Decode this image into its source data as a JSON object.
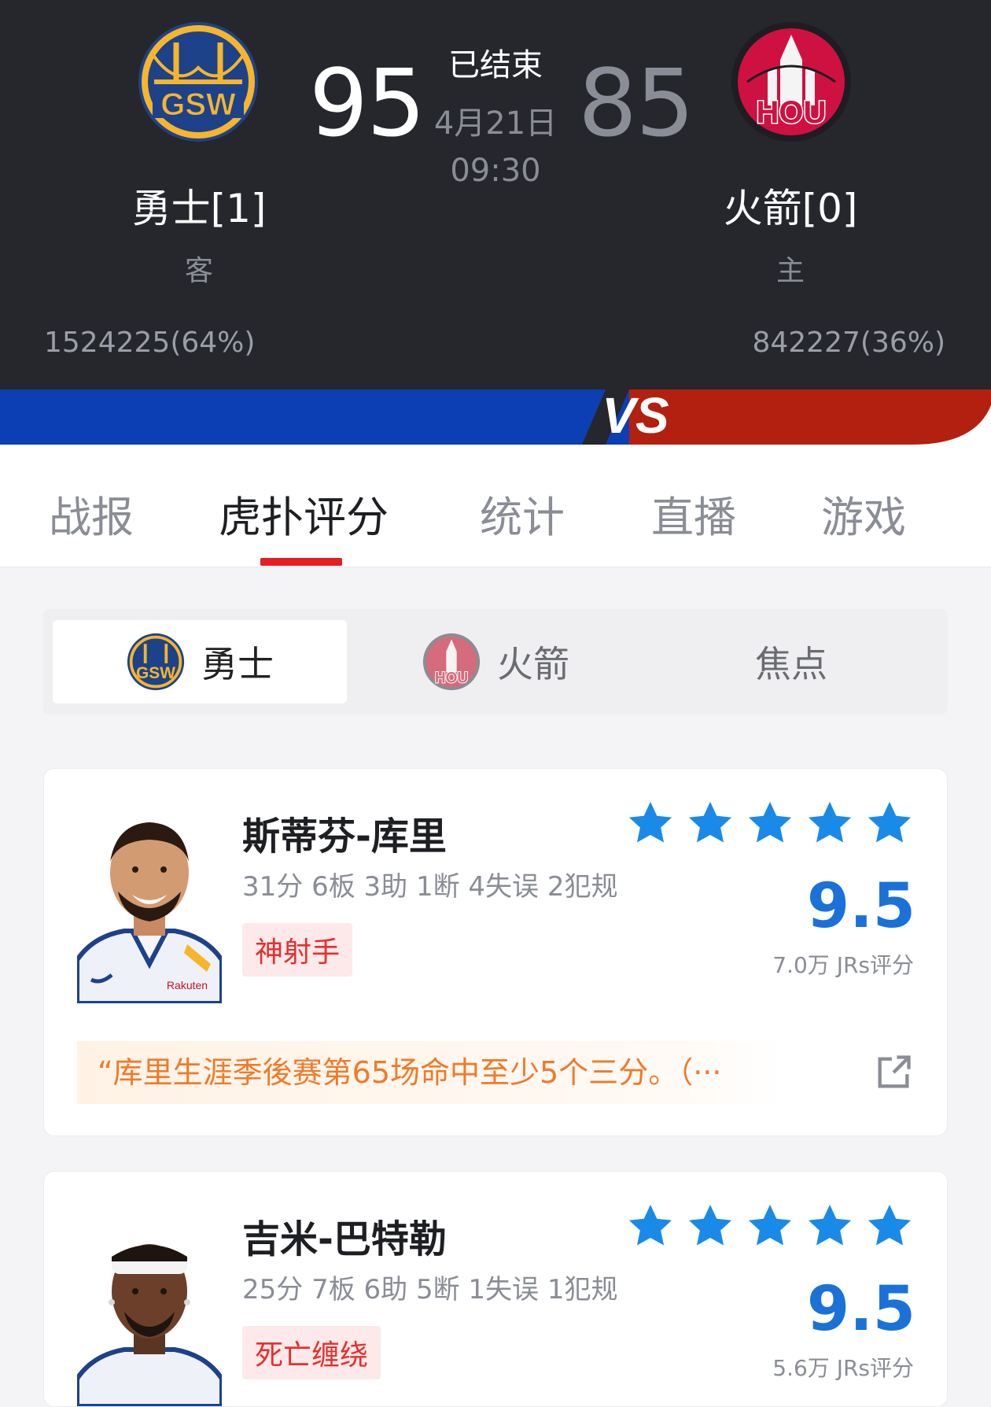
{
  "game": {
    "status": "已结束",
    "date": "4月21日",
    "time": "09:30",
    "away": {
      "abbr": "GSW",
      "name": "勇士[1]",
      "side": "客",
      "score": "95",
      "support": "1524225(64%)",
      "color": "#1d428a",
      "accent": "#f7b52c"
    },
    "home": {
      "abbr": "HOU",
      "name": "火箭[0]",
      "side": "主",
      "score": "85",
      "support": "842227(36%)",
      "color": "#ce1141",
      "accent": "#ffffff"
    },
    "vs_label": "VS"
  },
  "tabs": [
    "战报",
    "虎扑评分",
    "统计",
    "直播",
    "游戏"
  ],
  "active_tab": "虎扑评分",
  "segments": {
    "warriors": "勇士",
    "rockets": "火箭",
    "focus": "焦点"
  },
  "players": [
    {
      "name": "斯蒂芬-库里",
      "stats": "31分 6板 3助 1断 4失误 2犯规",
      "badge": "神射手",
      "stars": 5,
      "rating": "9.5",
      "rating_count": "7.0万 JRs评分",
      "quote": "“库里生涯季後赛第65场命中至少5个三分。（···"
    },
    {
      "name": "吉米-巴特勒",
      "stats": "25分 7板 6助 5断 1失误 1犯规",
      "badge": "死亡缠绕",
      "stars": 5,
      "rating": "9.5",
      "rating_count": "5.6万 JRs评分"
    }
  ],
  "colors": {
    "header_bg": "#25272d",
    "blue_bar": "#0c3fb3",
    "red_bar": "#b3200f",
    "tab_underline": "#e31f25",
    "star": "#1a8ae8",
    "rating": "#1a72d8"
  }
}
